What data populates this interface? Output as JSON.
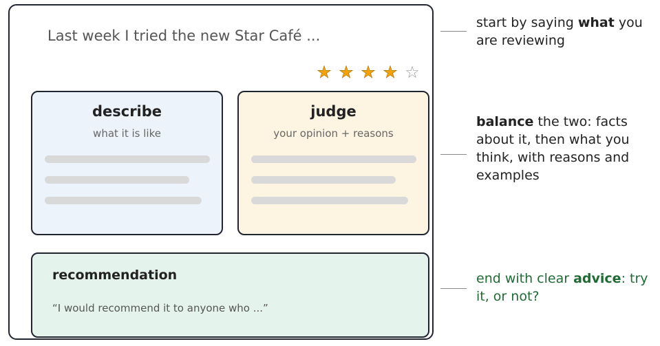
{
  "review_card": {
    "opening_line": "Last week I tried the new Star Café ...",
    "rating": {
      "stars": [
        "filled",
        "filled",
        "filled",
        "filled",
        "empty"
      ],
      "filled_count": 4,
      "max": 5,
      "filled_color": "#f0a30a"
    },
    "describe": {
      "title": "describe",
      "subtitle": "what it is like"
    },
    "judge": {
      "title": "judge",
      "subtitle": "your opinion + reasons"
    },
    "recommendation": {
      "title": "recommendation",
      "quote": "“I would recommend it to anyone who ...”"
    }
  },
  "notes": {
    "start": {
      "before": "start by saying ",
      "emphasis": "what",
      "after": " you are reviewing"
    },
    "balance": {
      "emphasis": "balance",
      "after": " the two: facts about it, then what you think, with reasons and examples"
    },
    "advice": {
      "before": "end with clear ",
      "emphasis": "advice",
      "after": ": try it, or not?"
    }
  },
  "colors": {
    "describe_bg": "#edf3fb",
    "judge_bg": "#fdf4e2",
    "recommendation_bg": "#e5f3ed",
    "advice_text": "#1f6b34"
  }
}
